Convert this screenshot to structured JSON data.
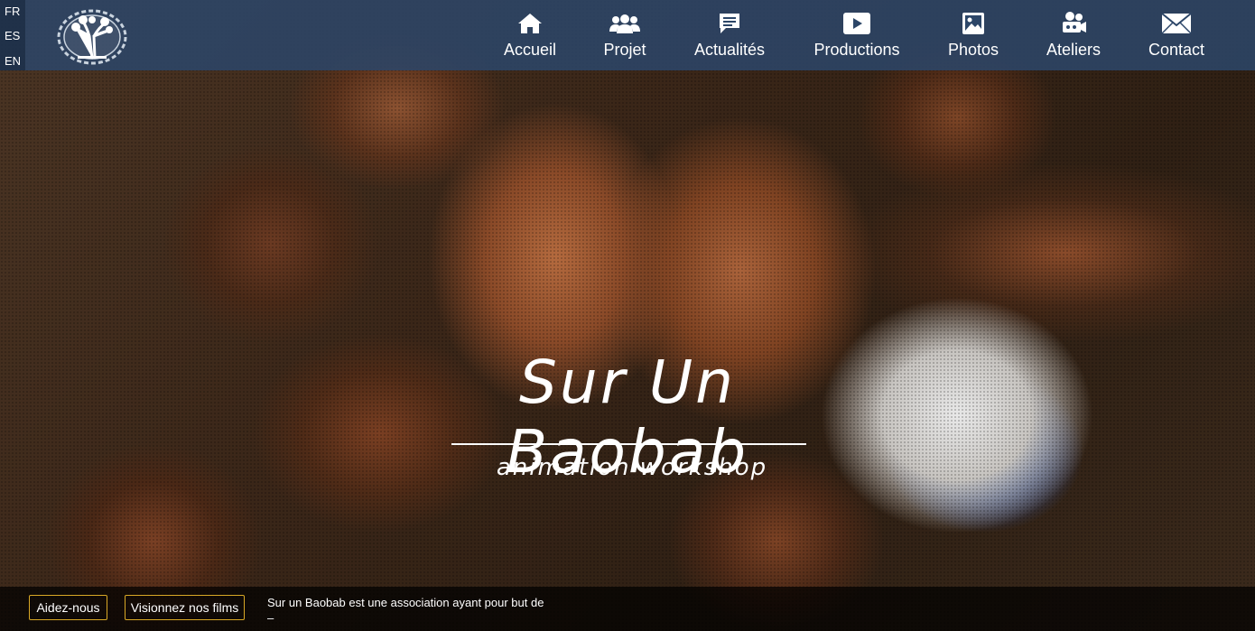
{
  "languages": [
    "FR",
    "ES",
    "EN"
  ],
  "nav": [
    {
      "label": "Accueil",
      "icon": "home-icon"
    },
    {
      "label": "Projet",
      "icon": "users-icon"
    },
    {
      "label": "Actualités",
      "icon": "chat-icon"
    },
    {
      "label": "Productions",
      "icon": "play-icon"
    },
    {
      "label": "Photos",
      "icon": "image-icon"
    },
    {
      "label": "Ateliers",
      "icon": "camera-icon"
    },
    {
      "label": "Contact",
      "icon": "mail-icon"
    }
  ],
  "hero": {
    "title": "Sur Un Baobab",
    "subtitle": "animation workshop"
  },
  "footer": {
    "help_label": "Aidez-nous",
    "films_label": "Visionnez nos films",
    "about_text": "Sur un Baobab est une association ayant pour but de",
    "about_more": "–"
  },
  "colors": {
    "nav_background": "#2c4668",
    "button_border": "#d9a826"
  }
}
